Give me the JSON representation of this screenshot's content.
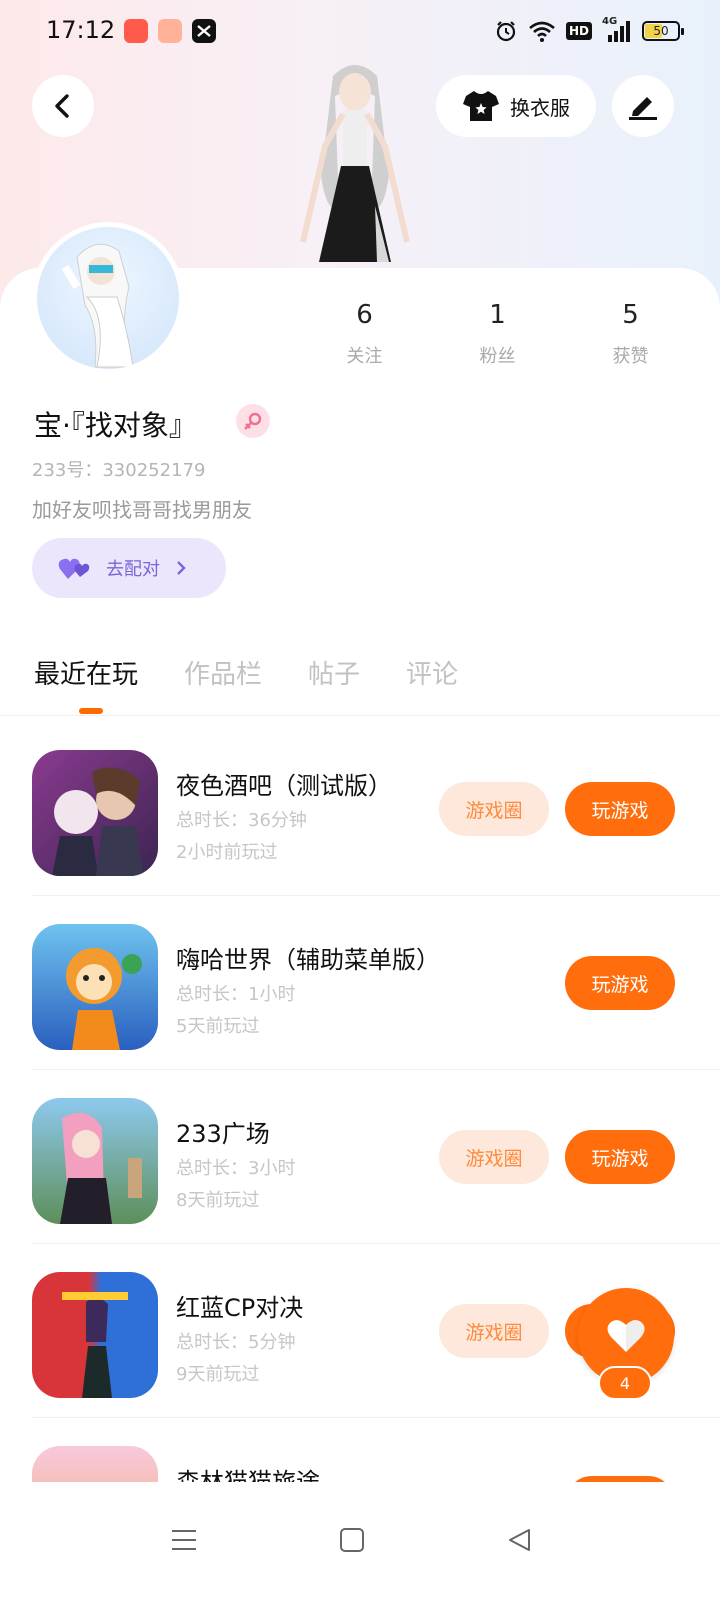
{
  "status_bar": {
    "time": "17:12",
    "hd": "HD",
    "network": "4G",
    "battery": "50",
    "icons": [
      "kuaishou-app-icon",
      "game-app-icon",
      "capcut-app-icon",
      "alarm-icon",
      "wifi-icon",
      "hd-icon",
      "signal-icon",
      "battery-icon"
    ]
  },
  "header": {
    "outfit_label": "换衣服"
  },
  "stats": [
    {
      "value": "6",
      "label": "关注"
    },
    {
      "value": "1",
      "label": "粉丝"
    },
    {
      "value": "5",
      "label": "获赞"
    }
  ],
  "profile": {
    "nickname": "宝·『找对象』",
    "id_line": "233号：330252179",
    "bio": "加好友呗找哥哥找男朋友",
    "match_label": "去配对"
  },
  "tabs": [
    "最近在玩",
    "作品栏",
    "帖子",
    "评论"
  ],
  "buttons": {
    "circle": "游戏圈",
    "play": "玩游戏"
  },
  "games": [
    {
      "title": "夜色酒吧（测试版）",
      "duration": "总时长：36分钟",
      "last_played": "2小时前玩过"
    },
    {
      "title": "嗨哈世界（辅助菜单版）",
      "duration": "总时长：1小时",
      "last_played": "5天前玩过"
    },
    {
      "title": "233广场",
      "duration": "总时长：3小时",
      "last_played": "8天前玩过"
    },
    {
      "title": "红蓝CP对决",
      "duration": "总时长：5分钟",
      "last_played": "9天前玩过"
    },
    {
      "title": "森林猫猫旅途",
      "duration": "",
      "last_played": ""
    }
  ],
  "like_count": "4",
  "colors": {
    "accent": "#ff6d0c",
    "accent_light": "#fde8db",
    "match_bg": "#ebe6fb",
    "match_text": "#7a66d8"
  }
}
